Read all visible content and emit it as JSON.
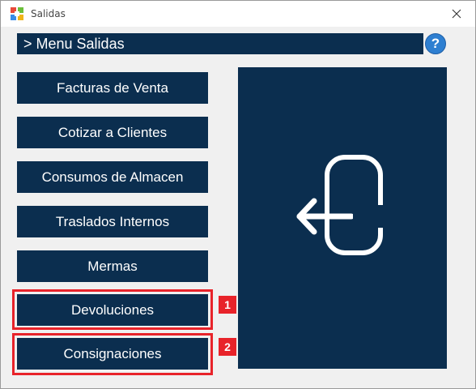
{
  "window": {
    "title": "Salidas"
  },
  "header": {
    "title": "> Menu Salidas"
  },
  "help": {
    "label": "?"
  },
  "menu": {
    "items": [
      {
        "label": "Facturas de Venta"
      },
      {
        "label": "Cotizar a Clientes"
      },
      {
        "label": "Consumos de Almacen"
      },
      {
        "label": "Traslados Internos"
      },
      {
        "label": "Mermas"
      },
      {
        "label": "Devoluciones"
      },
      {
        "label": "Consignaciones"
      }
    ]
  },
  "annotations": [
    {
      "label": "1"
    },
    {
      "label": "2"
    }
  ],
  "colors": {
    "primary": "#0b2e4f",
    "highlight": "#e8232a",
    "help": "#2e7fd1"
  },
  "icons": {
    "app": "colored-squares-icon",
    "close": "close-icon",
    "panel": "exit-arrow-icon"
  }
}
